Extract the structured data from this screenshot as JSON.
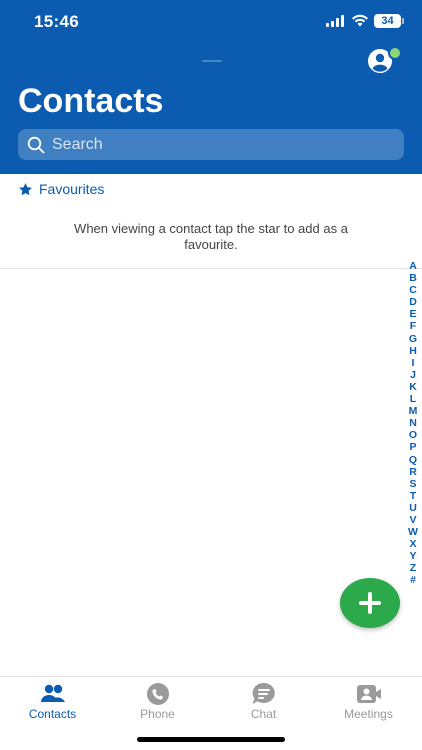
{
  "status_bar": {
    "time": "15:46",
    "battery": "34"
  },
  "header": {
    "title": "Contacts",
    "profile_icon": "person-circle-icon",
    "presence_color": "#8ed67a"
  },
  "search": {
    "placeholder": "Search",
    "value": ""
  },
  "favourites": {
    "label": "Favourites",
    "hint": "When viewing a contact tap the star to add as a favourite."
  },
  "alphabet_index": [
    "A",
    "B",
    "C",
    "D",
    "E",
    "F",
    "G",
    "H",
    "I",
    "J",
    "K",
    "L",
    "M",
    "N",
    "O",
    "P",
    "Q",
    "R",
    "S",
    "T",
    "U",
    "V",
    "W",
    "X",
    "Y",
    "Z",
    "#"
  ],
  "fab": {
    "icon": "plus-icon",
    "color": "#2ca94a"
  },
  "tabs": [
    {
      "label": "Contacts",
      "icon": "people-icon",
      "active": true
    },
    {
      "label": "Phone",
      "icon": "phone-icon",
      "active": false
    },
    {
      "label": "Chat",
      "icon": "chat-icon",
      "active": false
    },
    {
      "label": "Meetings",
      "icon": "video-icon",
      "active": false
    }
  ],
  "colors": {
    "brand": "#0b5cb0",
    "inactive": "#9a9a9a"
  }
}
